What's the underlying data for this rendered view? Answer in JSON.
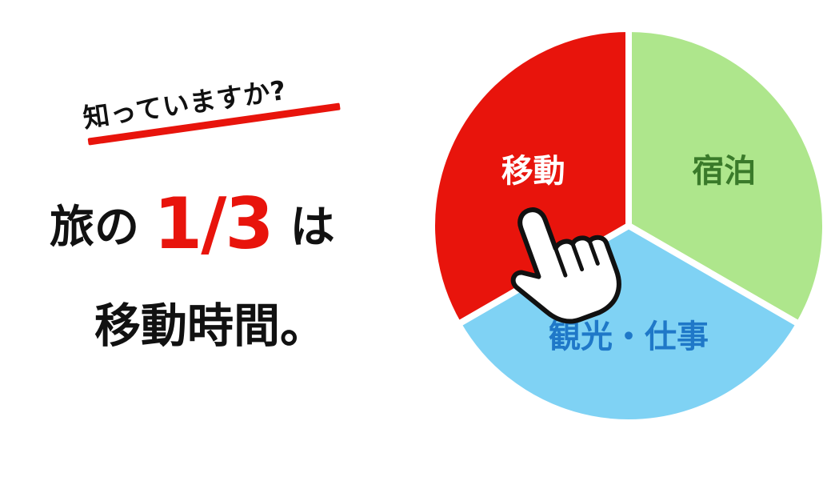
{
  "text": {
    "kicker": "知っていますか?",
    "headline_prefix": "旅の",
    "headline_fraction": "1/3",
    "headline_suffix": "は",
    "headline_line2": "移動時間。"
  },
  "chart_data": {
    "type": "pie",
    "categories": [
      "宿泊",
      "観光・仕事",
      "移動"
    ],
    "values": [
      33.3,
      33.3,
      33.3
    ],
    "colors": [
      "#aee68c",
      "#7fd2f4",
      "#e8140c"
    ],
    "label_colors": [
      "#3a7a2a",
      "#1f78c8",
      "#ffffff"
    ],
    "highlighted": "移動",
    "start_angle_deg": 0,
    "direction": "clockwise"
  },
  "icons": {
    "pointer": "pointing-hand-icon"
  }
}
